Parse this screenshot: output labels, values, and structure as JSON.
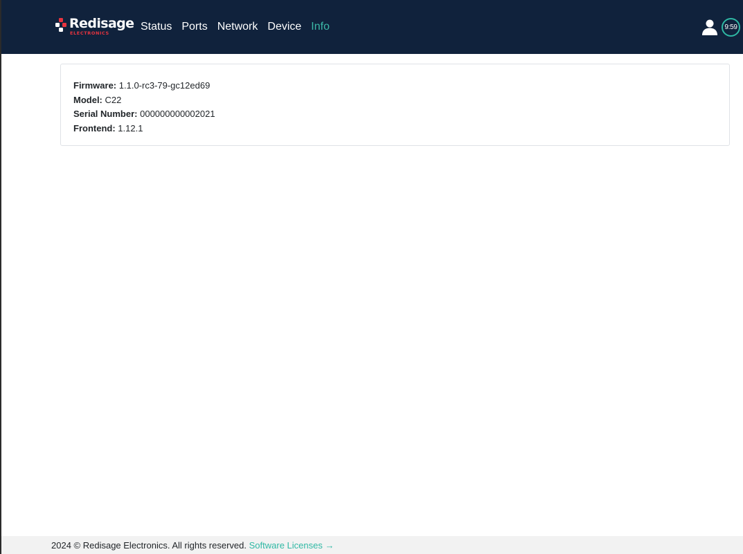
{
  "brand": {
    "name": "Redisage",
    "sub": "ELECTRONICS",
    "accent_color": "#e8343f"
  },
  "nav": {
    "items": [
      {
        "label": "Status",
        "active": false
      },
      {
        "label": "Ports",
        "active": false
      },
      {
        "label": "Network",
        "active": false
      },
      {
        "label": "Device",
        "active": false
      },
      {
        "label": "Info",
        "active": true
      }
    ],
    "active_color": "#3cb9a8",
    "background": "#10223c"
  },
  "header": {
    "user_icon": "user-icon",
    "session_timer": "9:59"
  },
  "info": {
    "firmware": {
      "label": "Firmware:",
      "value": "1.1.0-rc3-79-gc12ed69"
    },
    "model": {
      "label": "Model:",
      "value": "C22"
    },
    "serial": {
      "label": "Serial Number:",
      "value": "000000000002021"
    },
    "frontend": {
      "label": "Frontend:",
      "value": "1.12.1"
    }
  },
  "footer": {
    "copyright": "2024 © Redisage Electronics. All rights reserved.",
    "licenses_link": "Software Licenses →"
  }
}
